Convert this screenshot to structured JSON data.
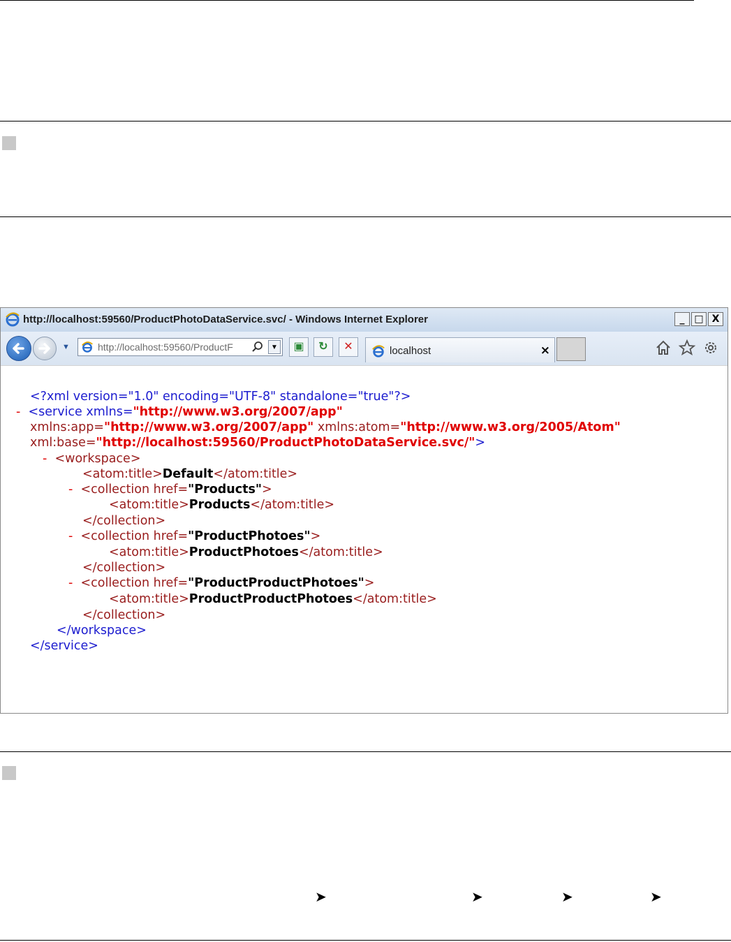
{
  "window": {
    "title": "http://localhost:59560/ProductPhotoDataService.svc/ - Windows Internet Explorer",
    "min_label": "_",
    "max_label": "□",
    "close_label": "X"
  },
  "toolbar": {
    "address_url": "http://localhost:59560/ProductF",
    "icons": [
      "back-icon",
      "forward-icon",
      "dropdown-icon",
      "ie-icon",
      "search-icon",
      "compatibility-icon",
      "refresh-icon",
      "stop-icon",
      "home-icon",
      "favorites-star-icon",
      "gear-icon"
    ],
    "stop_label": "✕",
    "refresh_label": "↻",
    "compat_label": "▣"
  },
  "tab": {
    "label": "localhost",
    "close": "×"
  },
  "xml": {
    "decl": "<?xml version=\"1.0\" encoding=\"UTF-8\" standalone=\"true\"?>",
    "service_open_prefix": "<service xmlns=",
    "service_xmlns": "\"http://www.w3.org/2007/app\"",
    "xmlns_app_name": "xmlns:app=",
    "xmlns_app_val": "\"http://www.w3.org/2007/app\"",
    "xmlns_atom_name": " xmlns:atom=",
    "xmlns_atom_val": "\"http://www.w3.org/2005/Atom\"",
    "xml_base_name": "xml:base=",
    "xml_base_val": "\"http://localhost:59560/ProductPhotoDataService.svc/\"",
    "close_bracket": ">",
    "workspace_open": "<workspace>",
    "default_title_open": "<atom:title>",
    "default_title": "Default",
    "title_close": "</atom:title>",
    "collections": [
      {
        "href_prefix": "<collection href=",
        "href": "\"Products\"",
        "title": "Products"
      },
      {
        "href_prefix": "<collection href=",
        "href": "\"ProductPhotoes\"",
        "title": "ProductPhotoes"
      },
      {
        "href_prefix": "<collection href=",
        "href": "\"ProductProductPhotoes\"",
        "title": "ProductProductPhotoes"
      }
    ],
    "collection_close": "</collection>",
    "workspace_close": "</workspace>",
    "service_close": "</service>",
    "minus": "-"
  },
  "breadcrumb_arrows": [
    "➤",
    "➤",
    "➤",
    "➤"
  ]
}
